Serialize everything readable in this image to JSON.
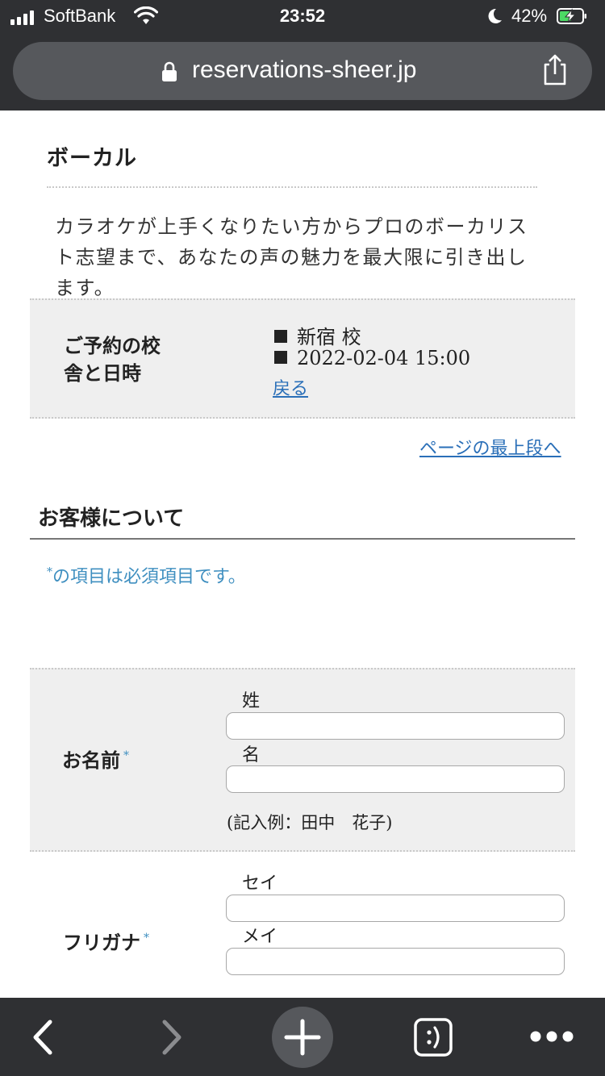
{
  "status_bar": {
    "carrier": "SoftBank",
    "time": "23:52",
    "battery_percent": "42%",
    "icons": [
      "signal-icon",
      "wifi-icon",
      "do-not-disturb-moon-icon",
      "battery-charging-icon"
    ]
  },
  "url_bar": {
    "url": "reservations-sheer.jp",
    "icons": [
      "lock-icon",
      "share-icon"
    ]
  },
  "course": {
    "title": "ボーカル",
    "description": "カラオケが上手くなりたい方からプロのボーカリスト志望まで、あなたの声の魅力を最大限に引き出します。"
  },
  "reservation": {
    "label_line1": "ご予約の校",
    "label_line2": "舎と日時",
    "school": "新宿 校",
    "datetime": "2022-02-04 15:00",
    "back_link": "戻る"
  },
  "page_top_link": "ページの最上段へ",
  "customer_section": {
    "title": "お客様について",
    "required_note_mark": "*",
    "required_note": "の項目は必須項目です。"
  },
  "form": {
    "name": {
      "label": "お名前",
      "required_mark": "*",
      "last_label": "姓",
      "last_value": "",
      "first_label": "名",
      "first_value": "",
      "example": "(記入例：田中　花子)"
    },
    "furigana": {
      "label": "フリガナ",
      "required_mark": "*",
      "last_label": "セイ",
      "last_value": "",
      "first_label": "メイ",
      "first_value": ""
    }
  },
  "toolbar": {
    "icons": [
      "back-arrow-icon",
      "forward-arrow-icon",
      "new-tab-plus-icon",
      "tabs-icon",
      "more-icon"
    ]
  },
  "colors": {
    "chrome_bg": "#2f3033",
    "url_bar_bg": "#56585c",
    "panel_bg": "#efefef",
    "link": "#2a6fb8",
    "required_mark": "#3f8fc0"
  }
}
